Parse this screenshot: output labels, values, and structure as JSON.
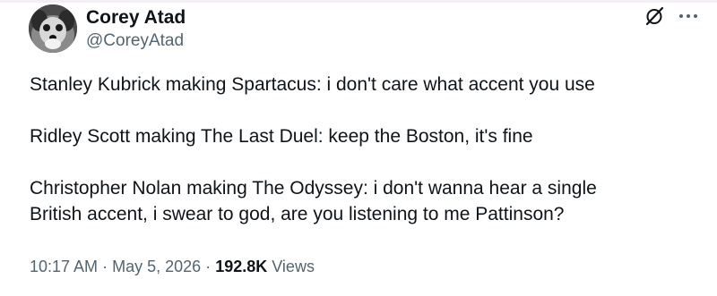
{
  "author": {
    "display_name": "Corey Atad",
    "handle": "@CoreyAtad",
    "avatar_icon": "dog-avatar"
  },
  "actions": {
    "grok_icon": "grok-icon",
    "more_icon": "more-icon"
  },
  "tweet": {
    "lines": [
      "Stanley Kubrick making Spartacus: i don't care what accent you use",
      "Ridley Scott making The Last Duel: keep the Boston, it's fine",
      "Christopher Nolan making The Odyssey: i don't wanna hear a single",
      "British accent, i swear to god, are you listening to me Pattinson?"
    ]
  },
  "meta": {
    "time": "10:17 AM",
    "separator1": "·",
    "date": "May 5, 2026",
    "separator2": "·",
    "views_count": "192.8K",
    "views_label": "Views"
  },
  "colors": {
    "text_primary": "#0f1419",
    "text_secondary": "#536471"
  }
}
